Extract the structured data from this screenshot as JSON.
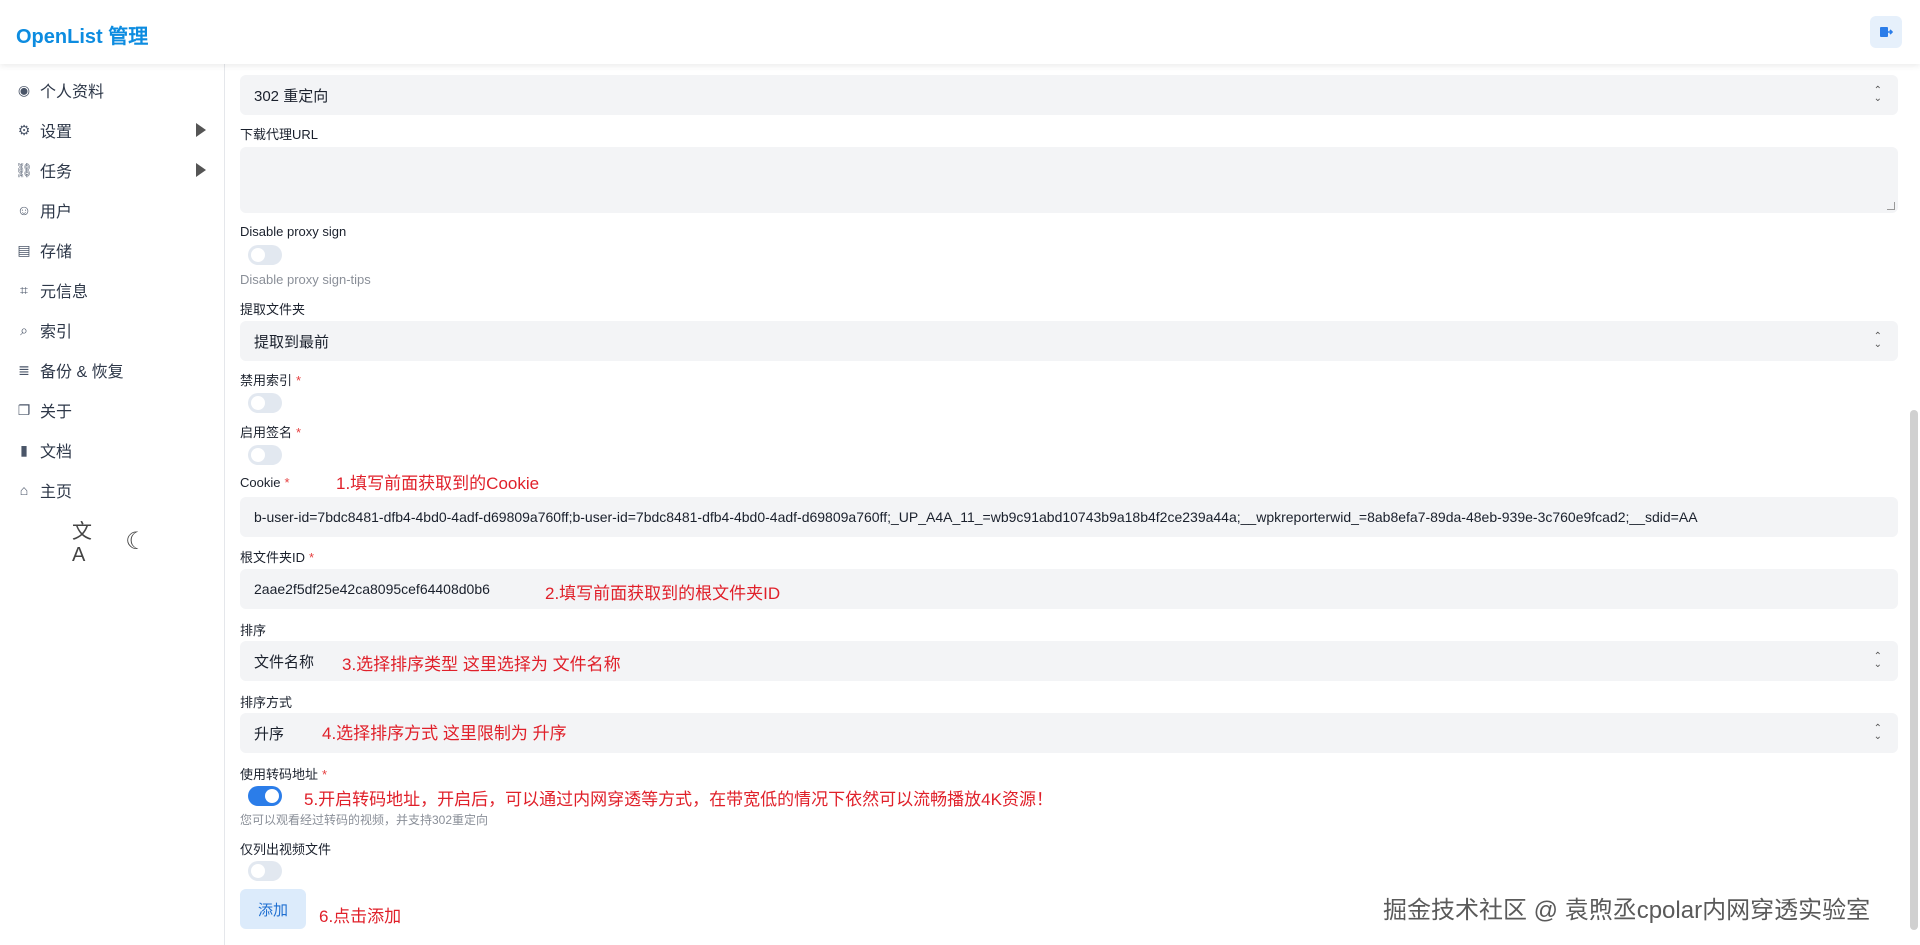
{
  "header": {
    "brand": "OpenList 管理"
  },
  "sidebar": {
    "items": [
      {
        "label": "个人资料",
        "icon": "fingerprint-icon",
        "glyph": "◉"
      },
      {
        "label": "设置",
        "icon": "gear-icon",
        "glyph": "⚙"
      },
      {
        "label": "任务",
        "icon": "route-icon",
        "glyph": "⛓"
      },
      {
        "label": "用户",
        "icon": "user-circle-icon",
        "glyph": "☺"
      },
      {
        "label": "存储",
        "icon": "storage-icon",
        "glyph": "▤"
      },
      {
        "label": "元信息",
        "icon": "meta-icon",
        "glyph": "⌗"
      },
      {
        "label": "索引",
        "icon": "search-icon",
        "glyph": "⌕"
      },
      {
        "label": "备份 & 恢复",
        "icon": "database-icon",
        "glyph": "≣"
      },
      {
        "label": "关于",
        "icon": "copy-icon",
        "glyph": "❐"
      },
      {
        "label": "文档",
        "icon": "book-icon",
        "glyph": "▮"
      },
      {
        "label": "主页",
        "icon": "home-icon",
        "glyph": "⌂"
      }
    ],
    "tools": {
      "translate_glyph": "文A",
      "theme_glyph": "☾"
    }
  },
  "form": {
    "webdav_policy_value": "302 重定向",
    "download_proxy_label": "下载代理URL",
    "disable_proxy_sign_label": "Disable proxy sign",
    "disable_proxy_sign_tip": "Disable proxy sign-tips",
    "extract_folder_label": "提取文件夹",
    "extract_folder_value": "提取到最前",
    "disable_index_label": "禁用索引",
    "enable_sign_label": "启用签名",
    "cookie_label": "Cookie",
    "cookie_value": "b-user-id=7bdc8481-dfb4-4bd0-4adf-d69809a760ff;b-user-id=7bdc8481-dfb4-4bd0-4adf-d69809a760ff;_UP_A4A_11_=wb9c91abd10743b9a18b4f2ce239a44a;__wpkreporterwid_=8ab8efa7-89da-48eb-939e-3c760e9fcad2;__sdid=AA",
    "root_folder_label": "根文件夹ID",
    "root_folder_value": "2aae2f5df25e42ca8095cef64408d0b6",
    "order_by_label": "排序",
    "order_by_value": "文件名称",
    "order_direction_label": "排序方式",
    "order_direction_value": "升序",
    "transcode_label": "使用转码地址",
    "transcode_tip": "您可以观看经过转码的视频，并支持302重定向",
    "only_video_label": "仅列出视频文件",
    "required_mark": "*",
    "add_button": "添加"
  },
  "toggles": {
    "disable_proxy_sign": false,
    "disable_index": false,
    "enable_sign": false,
    "transcode": true,
    "only_video": false
  },
  "annotations": {
    "a1": "1.填写前面获取到的Cookie",
    "a2": "2.填写前面获取到的根文件夹ID",
    "a3": "3.选择排序类型 这里选择为 文件名称",
    "a4": "4.选择排序方式  这里限制为 升序",
    "a5": "5.开启转码地址，开启后，可以通过内网穿透等方式，在带宽低的情况下依然可以流畅播放4K资源！",
    "a6": "6.点击添加"
  },
  "watermark": "掘金技术社区 @ 袁煦丞cpolar内网穿透实验室"
}
